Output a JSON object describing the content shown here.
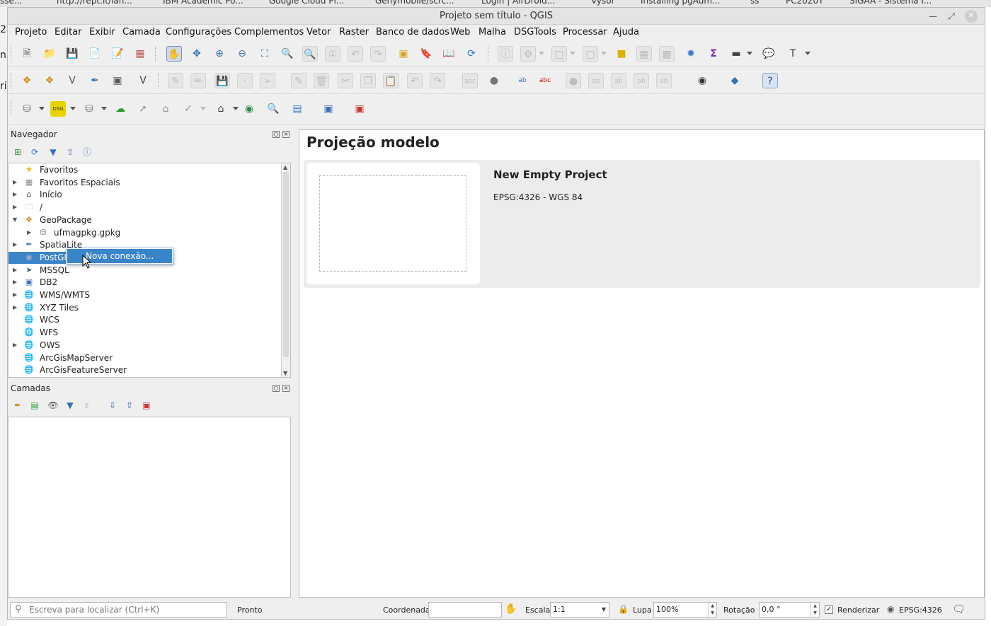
{
  "browser_tabs": [
    "sse...",
    "http://rept.it/lah...",
    "IBM Academic Po...",
    "Google Cloud Pl...",
    "Genymobile/scrc...",
    "Login | AirDroid...",
    "Vysor",
    "Installing pgAdm...",
    "ss",
    "PC2020T",
    "SIGAA - Sistema I..."
  ],
  "window": {
    "title": "Projeto sem título - QGIS"
  },
  "menu": [
    "Projeto",
    "Editar",
    "Exibir",
    "Camada",
    "Configurações",
    "Complementos",
    "Vetor",
    "Raster",
    "Banco de dados",
    "Web",
    "Malha",
    "DSGTools",
    "Processar",
    "Ajuda"
  ],
  "navigator": {
    "title": "Navegador",
    "items": [
      {
        "label": "Favoritos",
        "icon": "star-icon",
        "expandable": false
      },
      {
        "label": "Favoritos Espaciais",
        "icon": "spatial-bookmark-icon",
        "expandable": true
      },
      {
        "label": "Início",
        "icon": "home-folder-icon",
        "expandable": true
      },
      {
        "label": "/",
        "icon": "folder-icon",
        "expandable": true
      },
      {
        "label": "GeoPackage",
        "icon": "geopackage-icon",
        "expandable": true,
        "expanded": true
      },
      {
        "label": "ufmagpkg.gpkg",
        "icon": "database-icon",
        "expandable": true,
        "child": true
      },
      {
        "label": "SpatiaLite",
        "icon": "spatialite-icon",
        "expandable": true
      },
      {
        "label": "PostGIS",
        "icon": "postgis-icon",
        "expandable": false,
        "selected": true
      },
      {
        "label": "MSSQL",
        "icon": "mssql-icon",
        "expandable": true
      },
      {
        "label": "DB2",
        "icon": "db2-icon",
        "expandable": true
      },
      {
        "label": "WMS/WMTS",
        "icon": "globe-icon",
        "expandable": true
      },
      {
        "label": "XYZ Tiles",
        "icon": "globe-icon",
        "expandable": true
      },
      {
        "label": "WCS",
        "icon": "globe-icon",
        "expandable": false
      },
      {
        "label": "WFS",
        "icon": "globe-icon",
        "expandable": false
      },
      {
        "label": "OWS",
        "icon": "globe-icon",
        "expandable": true
      },
      {
        "label": "ArcGisMapServer",
        "icon": "globe-icon",
        "expandable": false
      },
      {
        "label": "ArcGisFeatureServer",
        "icon": "globe-icon",
        "expandable": false
      }
    ]
  },
  "context_menu": {
    "item": "Nova conexão..."
  },
  "layers": {
    "title": "Camadas"
  },
  "main": {
    "title": "Projeção modelo",
    "template": {
      "name": "New Empty Project",
      "crs": "EPSG:4326 - WGS 84"
    }
  },
  "status": {
    "search_placeholder": "Escreva para localizar (Ctrl+K)",
    "message": "Pronto",
    "coord_label": "Coordenada",
    "coord_value": "",
    "scale_label": "Escala",
    "scale_value": "1:1",
    "magnifier_label": "Lupa",
    "magnifier_value": "100%",
    "rotation_label": "Rotação",
    "rotation_value": "0,0 °",
    "render_label": "Renderizar",
    "crs": "EPSG:4326"
  },
  "colors": {
    "selection": "#3a84c8",
    "accent": "#2a4f87"
  }
}
